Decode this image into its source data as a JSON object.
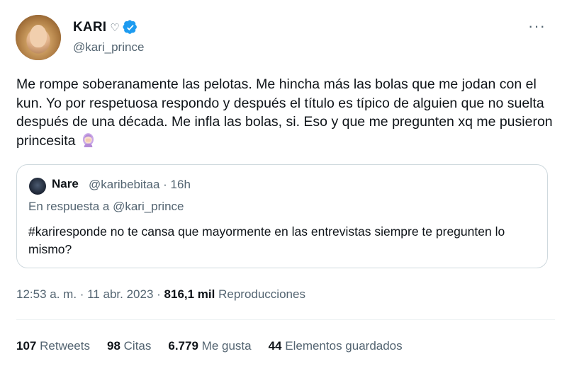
{
  "author": {
    "display_name": "KARI",
    "name_emoji": "♡",
    "handle": "@kari_prince",
    "verified_color": "#1d9bf0"
  },
  "more_icon": "more-horizontal-icon",
  "tweet": {
    "text": "Me rompe soberanamente las pelotas. Me hincha más las bolas que me jodan con el kun. Yo por respetuosa respondo y después el título es típico de alguien que no suelta después de una década. Me infla las bolas, si. Eso y que me pregunten xq me pusieron princesita",
    "emoji": "woman-facepalming-emoji"
  },
  "quote": {
    "name": "Nare",
    "handle_time": "@karibebitaa · 16h",
    "reply_to": "En respuesta a @kari_prince",
    "text": "#kariresponde no te cansa que mayormente en las entrevistas siempre te pregunten lo mismo?"
  },
  "meta": {
    "timestamp": "12:53 a. m. · 11 abr. 2023 · ",
    "views_count": "816,1 mil",
    "views_label": " Reproducciones"
  },
  "stats": [
    {
      "num": "107",
      "label": "Retweets"
    },
    {
      "num": "98",
      "label": "Citas"
    },
    {
      "num": "6.779",
      "label": "Me gusta"
    },
    {
      "num": "44",
      "label": "Elementos guardados"
    }
  ]
}
